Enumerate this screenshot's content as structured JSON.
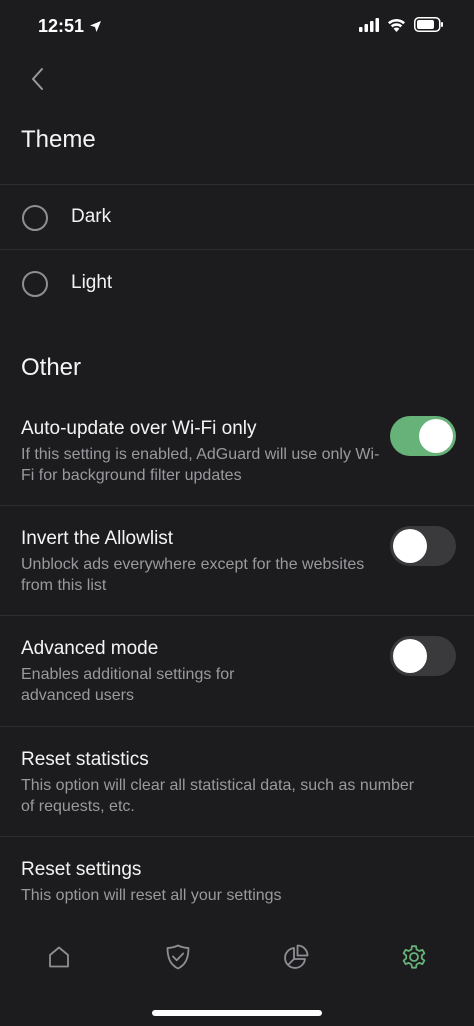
{
  "status_bar": {
    "time": "12:51"
  },
  "theme_section": {
    "title": "Theme",
    "options": [
      {
        "label": "Dark"
      },
      {
        "label": "Light"
      }
    ]
  },
  "other_section": {
    "title": "Other",
    "settings": [
      {
        "title": "Auto-update over Wi-Fi only",
        "description": "If this setting is enabled, AdGuard will use only Wi-Fi for background filter updates",
        "enabled": true
      },
      {
        "title": "Invert the Allowlist",
        "description": "Unblock ads everywhere except for the websites from this list",
        "enabled": false
      },
      {
        "title": "Advanced mode",
        "description": "Enables additional settings for advanced users",
        "enabled": false
      },
      {
        "title": "Reset statistics",
        "description": "This option will clear all statistical data, such as number of requests, etc."
      },
      {
        "title": "Reset settings",
        "description": "This option will reset all your settings"
      }
    ]
  },
  "tab_bar": {
    "tabs": [
      {
        "icon": "home-icon"
      },
      {
        "icon": "shield-icon"
      },
      {
        "icon": "statistics-icon"
      },
      {
        "icon": "settings-icon",
        "active": true
      }
    ],
    "active_color": "#67b279"
  },
  "colors": {
    "background": "#1c1c1e",
    "accent": "#67b279"
  }
}
